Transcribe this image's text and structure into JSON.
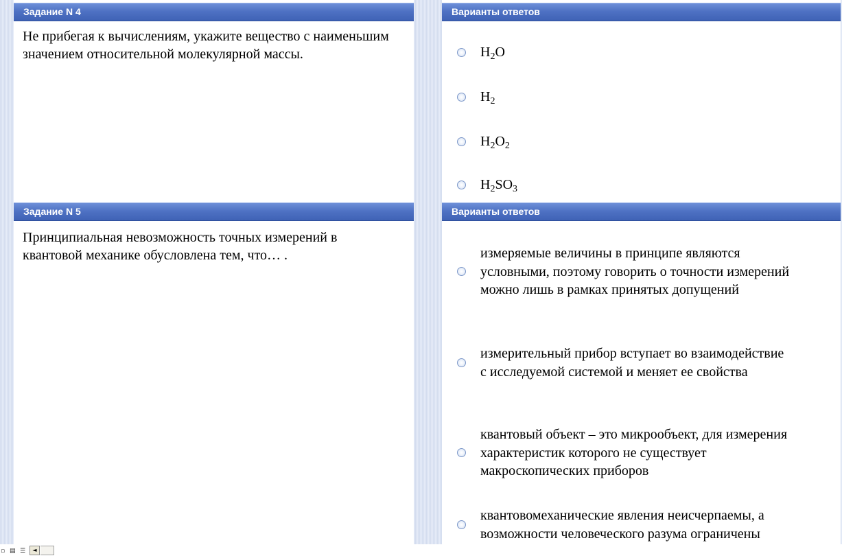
{
  "task4": {
    "header": "Задание N 4",
    "question": "Не прибегая к вычислениям, укажите вещество с наименьшим значением относительной молекулярной массы.",
    "answers_header": "Варианты ответов",
    "options": [
      {
        "parts": [
          "H",
          "2",
          "O"
        ]
      },
      {
        "parts": [
          "H",
          "2"
        ]
      },
      {
        "parts": [
          "H",
          "2",
          "O",
          "2"
        ]
      },
      {
        "parts": [
          "H",
          "2",
          "SO",
          "3"
        ]
      }
    ]
  },
  "task5": {
    "header": "Задание N 5",
    "question": "Принципиальная невозможность точных измерений в квантовой механике обусловлена тем, что… .",
    "answers_header": "Варианты ответов",
    "options": [
      "измеряемые величины в принципе являются условными, поэтому говорить о точности измерений можно лишь в рамках принятых допущений",
      "измерительный прибор вступает во взаимодействие с исследуемой системой и меняет ее свойства",
      "квантовый объект – это микрообъект, для измерения характеристик которого не существует макроскопических приборов",
      "квантовомеханические явления неисчерпаемы, а возможности человеческого разума ограничены"
    ]
  },
  "statusbar": {
    "icons": [
      "view-normal-icon",
      "view-web-icon",
      "view-outline-icon"
    ],
    "scroll_left": "◄"
  },
  "colors": {
    "header_bg": "#4f72c4",
    "stripe_bg": "#dde4f3",
    "radio_border": "#7d98c9"
  }
}
